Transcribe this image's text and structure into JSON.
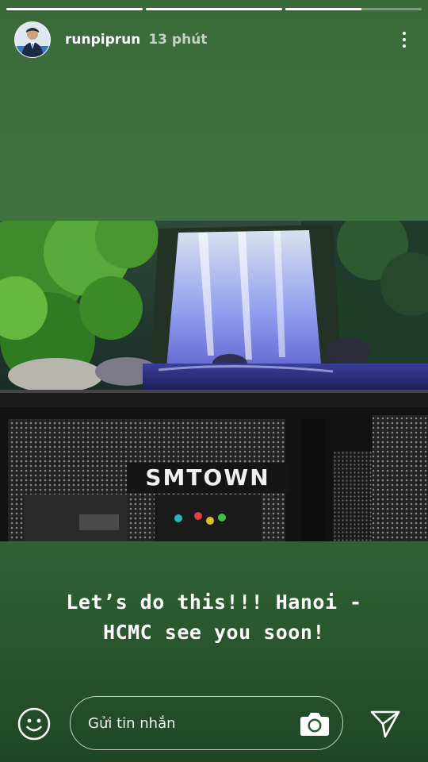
{
  "story": {
    "progress": [
      1.0,
      1.0,
      0.56
    ],
    "username": "runpiprun",
    "timestamp": "13 phút",
    "caption_line1": "Let’s do this!!! Hanoi -",
    "caption_line2": "HCMC see you soon!",
    "photo_sign_text": "SMTOWN"
  },
  "reply_bar": {
    "placeholder": "Gửi tin nhắn"
  },
  "icons": {
    "more": "more-vertical-icon",
    "emoji": "smiley-icon",
    "camera": "camera-icon",
    "send": "send-icon"
  },
  "colors": {
    "background_top": "#3f7340",
    "background_bottom": "#1f4726",
    "text": "#ffffff"
  }
}
